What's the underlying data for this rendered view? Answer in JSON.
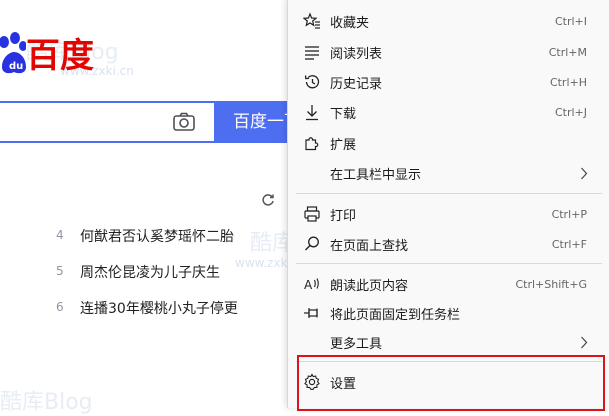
{
  "baidu": {
    "logo_text": "百度",
    "search_value": "",
    "search_button_label": "百度一下",
    "hot_list": [
      {
        "index": "4",
        "title": "何猷君否认奚梦瑶怀二胎"
      },
      {
        "index": "5",
        "title": "周杰伦昆凌为儿子庆生"
      },
      {
        "index": "6",
        "title": "连播30年樱桃小丸子停更"
      }
    ]
  },
  "watermarks": {
    "brand": "酷库Blog",
    "url": "www.zxki.cn"
  },
  "menu": {
    "items": [
      {
        "label": "收藏夹",
        "shortcut": "Ctrl+I",
        "icon": "favorites-icon"
      },
      {
        "label": "阅读列表",
        "shortcut": "Ctrl+M",
        "icon": "reading-list-icon"
      },
      {
        "label": "历史记录",
        "shortcut": "Ctrl+H",
        "icon": "history-icon"
      },
      {
        "label": "下载",
        "shortcut": "Ctrl+J",
        "icon": "download-icon"
      },
      {
        "label": "扩展",
        "shortcut": "",
        "icon": "extensions-icon"
      },
      {
        "label": "在工具栏中显示",
        "shortcut": "",
        "icon": ""
      },
      {
        "label": "打印",
        "shortcut": "Ctrl+P",
        "icon": "print-icon"
      },
      {
        "label": "在页面上查找",
        "shortcut": "Ctrl+F",
        "icon": "find-icon"
      },
      {
        "label": "朗读此页内容",
        "shortcut": "Ctrl+Shift+G",
        "icon": "read-aloud-icon"
      },
      {
        "label": "将此页面固定到任务栏",
        "shortcut": "",
        "icon": "pin-icon"
      },
      {
        "label": "更多工具",
        "shortcut": "",
        "icon": ""
      },
      {
        "label": "设置",
        "shortcut": "",
        "icon": "settings-icon"
      }
    ]
  },
  "colors": {
    "baidu_blue": "#4e6ef2",
    "baidu_red": "#e10601",
    "highlight_red": "#d9141a",
    "menu_bg": "#f9f9f9"
  }
}
